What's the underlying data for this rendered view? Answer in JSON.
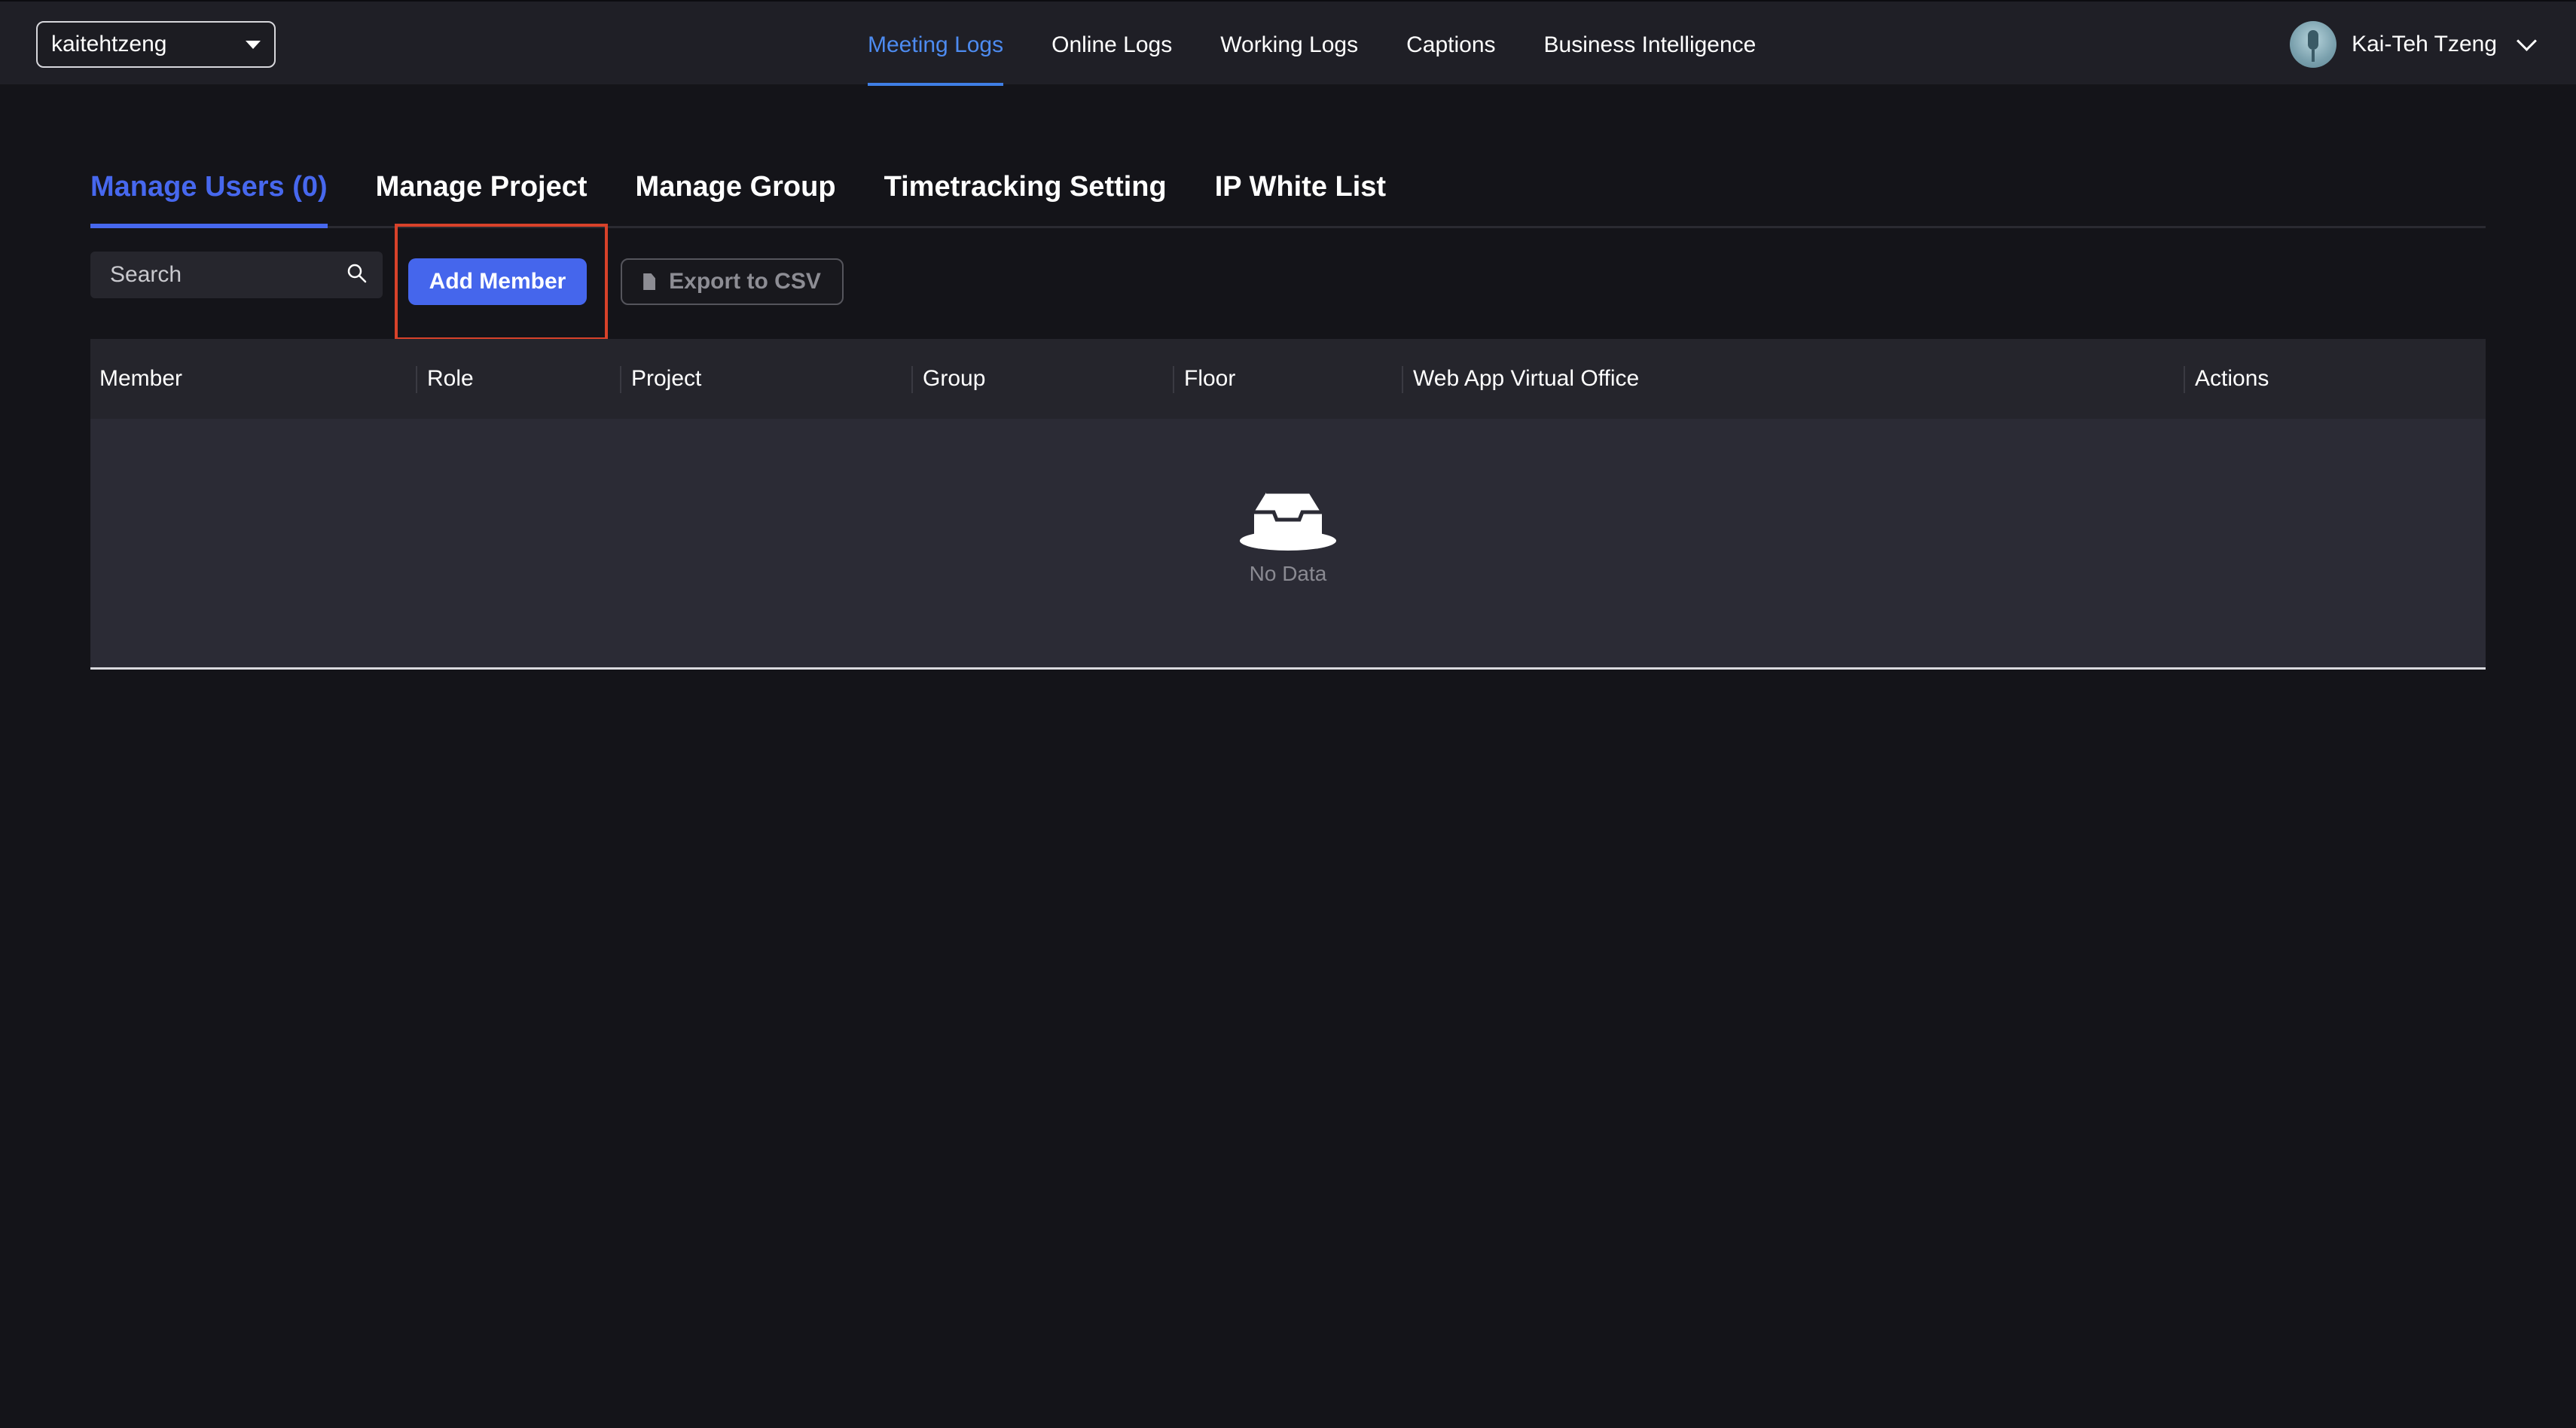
{
  "org_select": {
    "value": "kaitehtzeng"
  },
  "top_nav": {
    "items": [
      {
        "label": "Meeting Logs",
        "active": true
      },
      {
        "label": "Online Logs",
        "active": false
      },
      {
        "label": "Working Logs",
        "active": false
      },
      {
        "label": "Captions",
        "active": false
      },
      {
        "label": "Business Intelligence",
        "active": false
      }
    ]
  },
  "user": {
    "name": "Kai-Teh Tzeng",
    "avatar_icon": "microphone-avatar"
  },
  "tabs": [
    {
      "label": "Manage Users (0)",
      "active": true
    },
    {
      "label": "Manage Project",
      "active": false
    },
    {
      "label": "Manage Group",
      "active": false
    },
    {
      "label": "Timetracking Setting",
      "active": false
    },
    {
      "label": "IP White List",
      "active": false
    }
  ],
  "toolbar": {
    "search_placeholder": "Search",
    "add_member_label": "Add Member",
    "export_label": "Export to CSV"
  },
  "table": {
    "columns": [
      "Member",
      "Role",
      "Project",
      "Group",
      "Floor",
      "Web App Virtual Office",
      "Actions"
    ],
    "empty_text": "No Data"
  },
  "colors": {
    "accent": "#4768ee",
    "nav_active": "#4d8bf0",
    "highlight": "#d8422a",
    "background": "#141419"
  }
}
